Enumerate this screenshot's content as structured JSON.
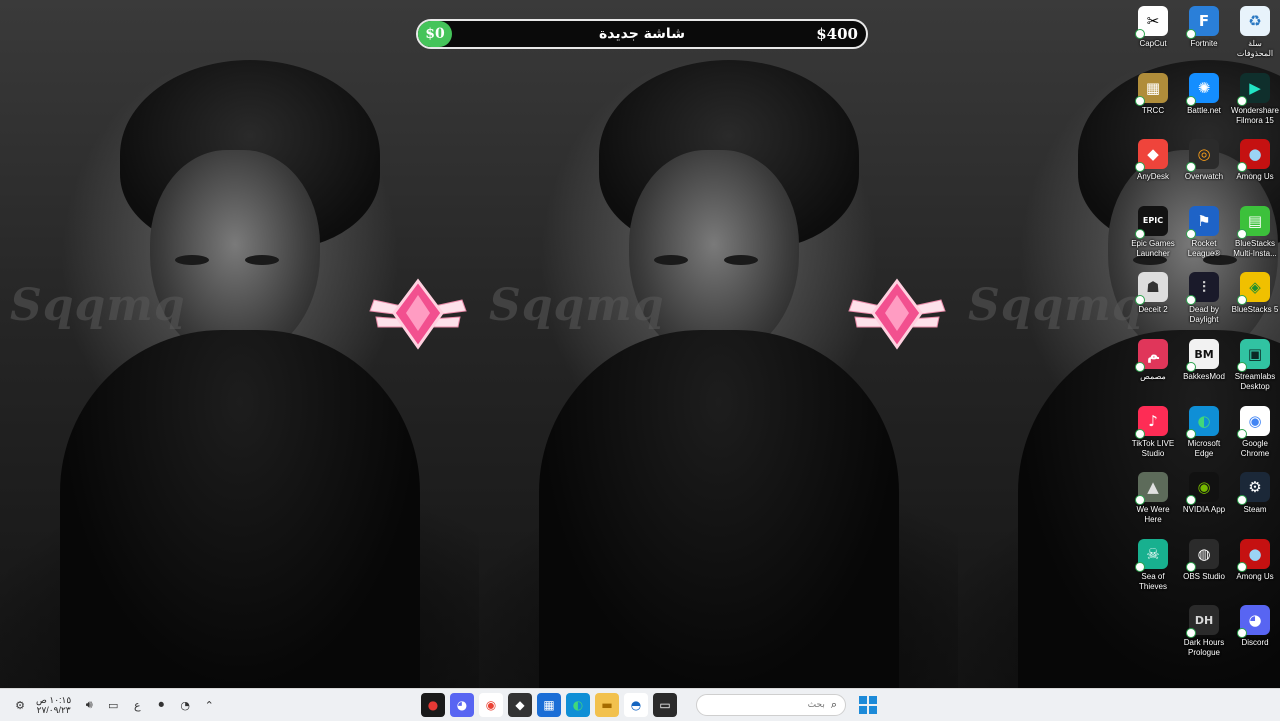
{
  "wallpaper": {
    "watermark_text": "Sqqmq",
    "panels": 3
  },
  "topbar": {
    "left_amount": "$0",
    "title": "شاشة جديدة",
    "right_amount": "$400"
  },
  "desktop_icons": [
    {
      "label": "CapCut",
      "icon": "capcut-icon",
      "bg": "#ffffff",
      "fg": "#000000",
      "glyph": "✂",
      "row": 0,
      "col": 0
    },
    {
      "label": "Fortnite",
      "icon": "fortnite-icon",
      "bg": "#2a7fd9",
      "fg": "#ffffff",
      "glyph": "F",
      "row": 0,
      "col": 1
    },
    {
      "label": "سلة المحذوفات",
      "icon": "recycle-bin-icon",
      "bg": "#e8f3fb",
      "fg": "#2b78c2",
      "glyph": "♻",
      "row": 0,
      "col": 2
    },
    {
      "label": "TRCC",
      "icon": "trcc-icon",
      "bg": "#b08d3a",
      "fg": "#ffffff",
      "glyph": "▦",
      "row": 1,
      "col": 0
    },
    {
      "label": "Battle.net",
      "icon": "battlenet-icon",
      "bg": "#148eff",
      "fg": "#ffffff",
      "glyph": "✺",
      "row": 1,
      "col": 1
    },
    {
      "label": "Wondershare Filmora 15",
      "icon": "filmora-icon",
      "bg": "#0f2f2c",
      "fg": "#22e3c3",
      "glyph": "▶",
      "row": 1,
      "col": 2
    },
    {
      "label": "AnyDesk",
      "icon": "anydesk-icon",
      "bg": "#ef443b",
      "fg": "#ffffff",
      "glyph": "◆",
      "row": 2,
      "col": 0
    },
    {
      "label": "Overwatch",
      "icon": "overwatch-icon",
      "bg": "#2b2b2b",
      "fg": "#f99e1a",
      "glyph": "◎",
      "row": 2,
      "col": 1
    },
    {
      "label": "Among Us",
      "icon": "among-us-icon",
      "bg": "#c51111",
      "fg": "#9bd4f5",
      "glyph": "●",
      "row": 2,
      "col": 2
    },
    {
      "label": "Epic Games Launcher",
      "icon": "epic-games-icon",
      "bg": "#121212",
      "fg": "#ffffff",
      "glyph": "EPIC",
      "row": 3,
      "col": 0
    },
    {
      "label": "Rocket League®",
      "icon": "rocket-league-icon",
      "bg": "#1e63c7",
      "fg": "#ffffff",
      "glyph": "⚑",
      "row": 3,
      "col": 1
    },
    {
      "label": "BlueStacks Multi-Insta...",
      "icon": "bluestacks-multi-icon",
      "bg": "#3cc13b",
      "fg": "#ffffff",
      "glyph": "▤",
      "row": 3,
      "col": 2
    },
    {
      "label": "Deceit 2",
      "icon": "deceit-icon",
      "bg": "#dddddd",
      "fg": "#333333",
      "glyph": "☗",
      "row": 4,
      "col": 0
    },
    {
      "label": "Dead by Daylight",
      "icon": "dead-by-daylight-icon",
      "bg": "#1a1a2a",
      "fg": "#d0d0d0",
      "glyph": "⫶",
      "row": 4,
      "col": 1
    },
    {
      "label": "BlueStacks 5",
      "icon": "bluestacks-icon",
      "bg": "#f0c000",
      "fg": "#1e8f2e",
      "glyph": "◈",
      "row": 4,
      "col": 2
    },
    {
      "label": "مصمص",
      "icon": "mesmes-icon",
      "bg": "#e0365a",
      "fg": "#ffffff",
      "glyph": "ﻢ",
      "row": 5,
      "col": 0
    },
    {
      "label": "BakkesMod",
      "icon": "bakkesmod-icon",
      "bg": "#f2f2f2",
      "fg": "#111111",
      "glyph": "BM",
      "row": 5,
      "col": 1
    },
    {
      "label": "Streamlabs Desktop",
      "icon": "streamlabs-icon",
      "bg": "#31c3a2",
      "fg": "#0c2a25",
      "glyph": "▣",
      "row": 5,
      "col": 2
    },
    {
      "label": "TikTok LIVE Studio",
      "icon": "tiktok-live-icon",
      "bg": "#fe2c55",
      "fg": "#ffffff",
      "glyph": "♪",
      "row": 6,
      "col": 0
    },
    {
      "label": "Microsoft Edge",
      "icon": "edge-icon",
      "bg": "#0f8fd6",
      "fg": "#41d87a",
      "glyph": "◐",
      "row": 6,
      "col": 1
    },
    {
      "label": "Google Chrome",
      "icon": "chrome-icon",
      "bg": "#ffffff",
      "fg": "#4285f4",
      "glyph": "◉",
      "row": 6,
      "col": 2
    },
    {
      "label": "We Were Here",
      "icon": "we-were-here-icon",
      "bg": "#5d6b5a",
      "fg": "#e0e0e0",
      "glyph": "▲",
      "row": 7,
      "col": 0
    },
    {
      "label": "NVIDIA App",
      "icon": "nvidia-icon",
      "bg": "#111111",
      "fg": "#76b900",
      "glyph": "◉",
      "row": 7,
      "col": 1
    },
    {
      "label": "Steam",
      "icon": "steam-icon",
      "bg": "#1b2838",
      "fg": "#ffffff",
      "glyph": "⚙",
      "row": 7,
      "col": 2
    },
    {
      "label": "Sea of Thieves",
      "icon": "sea-of-thieves-icon",
      "bg": "#18b08f",
      "fg": "#ffffff",
      "glyph": "☠",
      "row": 8,
      "col": 0
    },
    {
      "label": "OBS Studio",
      "icon": "obs-icon",
      "bg": "#2b2b2b",
      "fg": "#ffffff",
      "glyph": "◍",
      "row": 8,
      "col": 1
    },
    {
      "label": "Among Us",
      "icon": "among-us-icon",
      "bg": "#c51111",
      "fg": "#9bd4f5",
      "glyph": "●",
      "row": 8,
      "col": 2
    },
    {
      "label": "Dark Hours Prologue",
      "icon": "dark-hours-icon",
      "bg": "#2a2a2a",
      "fg": "#d8d8d8",
      "glyph": "DH",
      "row": 9,
      "col": 1
    },
    {
      "label": "Discord",
      "icon": "discord-icon",
      "bg": "#5865f2",
      "fg": "#ffffff",
      "glyph": "◕",
      "row": 9,
      "col": 2
    }
  ],
  "taskbar": {
    "clock_time": "١٠:١٥ ص",
    "clock_date": "٢٧/٠٩/٢٣",
    "language": "ع",
    "search_placeholder": "بحث",
    "tray_icons": [
      "settings-gear-icon",
      "volume-icon",
      "network-icon"
    ],
    "pinned_apps": [
      {
        "name": "record-app-icon",
        "bg": "#1a1a1a",
        "fg": "#e53935",
        "glyph": "●"
      },
      {
        "name": "discord-taskbar-icon",
        "bg": "#5865f2",
        "fg": "#ffffff",
        "glyph": "◕"
      },
      {
        "name": "chrome-taskbar-icon",
        "bg": "#ffffff",
        "fg": "#ea4335",
        "glyph": "◉"
      },
      {
        "name": "unity-icon",
        "bg": "#333333",
        "fg": "#ffffff",
        "glyph": "◆"
      },
      {
        "name": "microsoft-store-icon",
        "bg": "#1b6ed6",
        "fg": "#ffffff",
        "glyph": "▦"
      },
      {
        "name": "edge-taskbar-icon",
        "bg": "#0f8fd6",
        "fg": "#41d87a",
        "glyph": "◐"
      },
      {
        "name": "file-explorer-icon",
        "bg": "#f2c14e",
        "fg": "#a56b00",
        "glyph": "▬"
      },
      {
        "name": "hwinfo-icon",
        "bg": "#ffffff",
        "fg": "#1565c0",
        "glyph": "◓"
      },
      {
        "name": "terminal-icon",
        "bg": "#2b2b2b",
        "fg": "#ffffff",
        "glyph": "▭"
      }
    ]
  }
}
